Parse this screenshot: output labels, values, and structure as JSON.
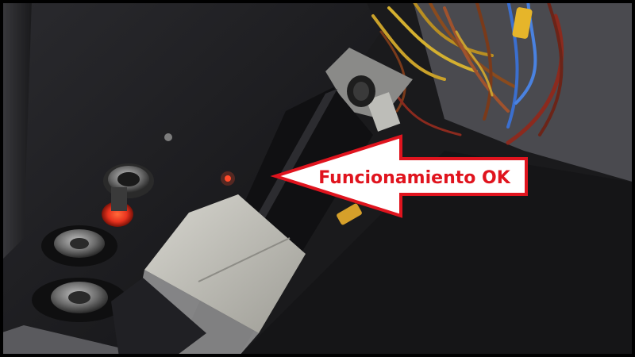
{
  "annotation": {
    "label": "Funcionamiento OK",
    "text_color": "#e0141e",
    "arrow_fill": "#ffffff",
    "arrow_stroke": "#e0141e"
  },
  "scene": {
    "border_color": "#000000",
    "panel_color": "#1d1d20",
    "indicator_color": "#e8321e"
  }
}
